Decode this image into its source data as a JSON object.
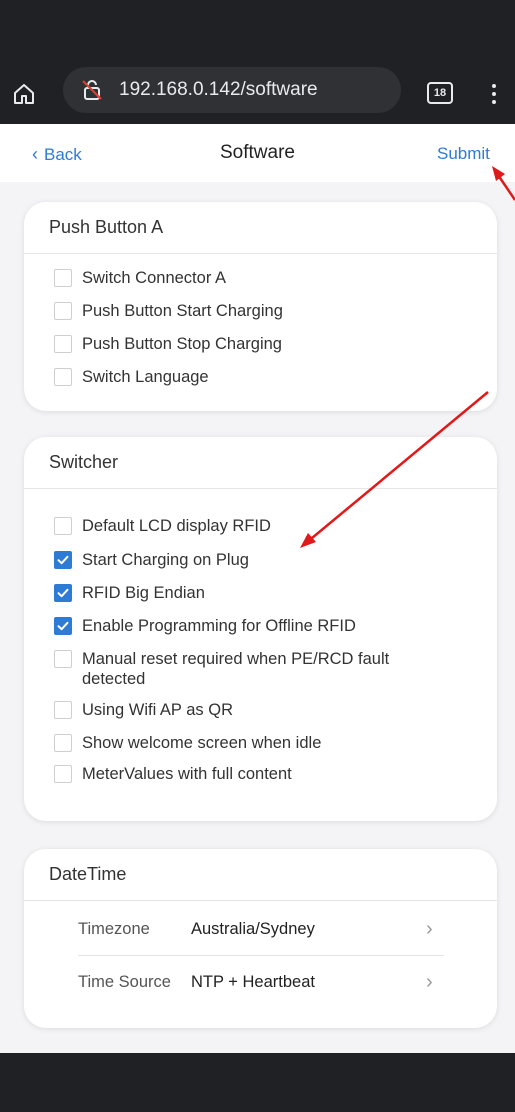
{
  "browser": {
    "url": "192.168.0.142/software",
    "tab_count": "18"
  },
  "nav": {
    "back_label": "Back",
    "title": "Software",
    "submit_label": "Submit"
  },
  "push_button": {
    "header": "Push Button A",
    "items": [
      {
        "label": "Switch Connector A",
        "checked": false
      },
      {
        "label": "Push Button Start Charging",
        "checked": false
      },
      {
        "label": "Push Button Stop Charging",
        "checked": false
      },
      {
        "label": "Switch Language",
        "checked": false
      }
    ]
  },
  "switcher": {
    "header": "Switcher",
    "items": [
      {
        "label": "Default LCD display RFID",
        "checked": false
      },
      {
        "label": "Start Charging on Plug",
        "checked": true
      },
      {
        "label": "RFID Big Endian",
        "checked": true
      },
      {
        "label": "Enable Programming for Offline RFID",
        "checked": true
      },
      {
        "label": "Manual reset required when PE/RCD fault detected",
        "checked": false
      },
      {
        "label": "Using Wifi AP as QR",
        "checked": false
      },
      {
        "label": "Show welcome screen when idle",
        "checked": false
      },
      {
        "label": "MeterValues with full content",
        "checked": false
      }
    ]
  },
  "datetime": {
    "header": "DateTime",
    "rows": [
      {
        "key": "Timezone",
        "value": "Australia/Sydney"
      },
      {
        "key": "Time Source",
        "value": "NTP + Heartbeat"
      }
    ]
  },
  "colors": {
    "accent": "#2e7bd6",
    "annotation_arrow": "#e0191b",
    "chrome": "#202124"
  }
}
